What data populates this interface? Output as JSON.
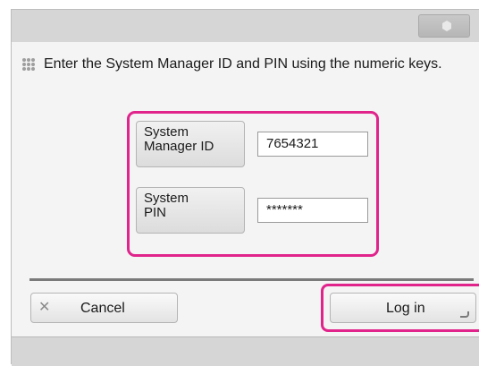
{
  "instruction": "Enter the System Manager ID and PIN using the numeric keys.",
  "fields": [
    {
      "label_line1": "System",
      "label_line2": "Manager ID",
      "value": "7654321"
    },
    {
      "label_line1": "System",
      "label_line2": "PIN",
      "value": "*******"
    }
  ],
  "buttons": {
    "cancel_label": "Cancel",
    "cancel_icon": "close-icon",
    "login_label": "Log in",
    "login_icon": "enter-icon"
  },
  "colors": {
    "highlight": "#e0248c"
  }
}
